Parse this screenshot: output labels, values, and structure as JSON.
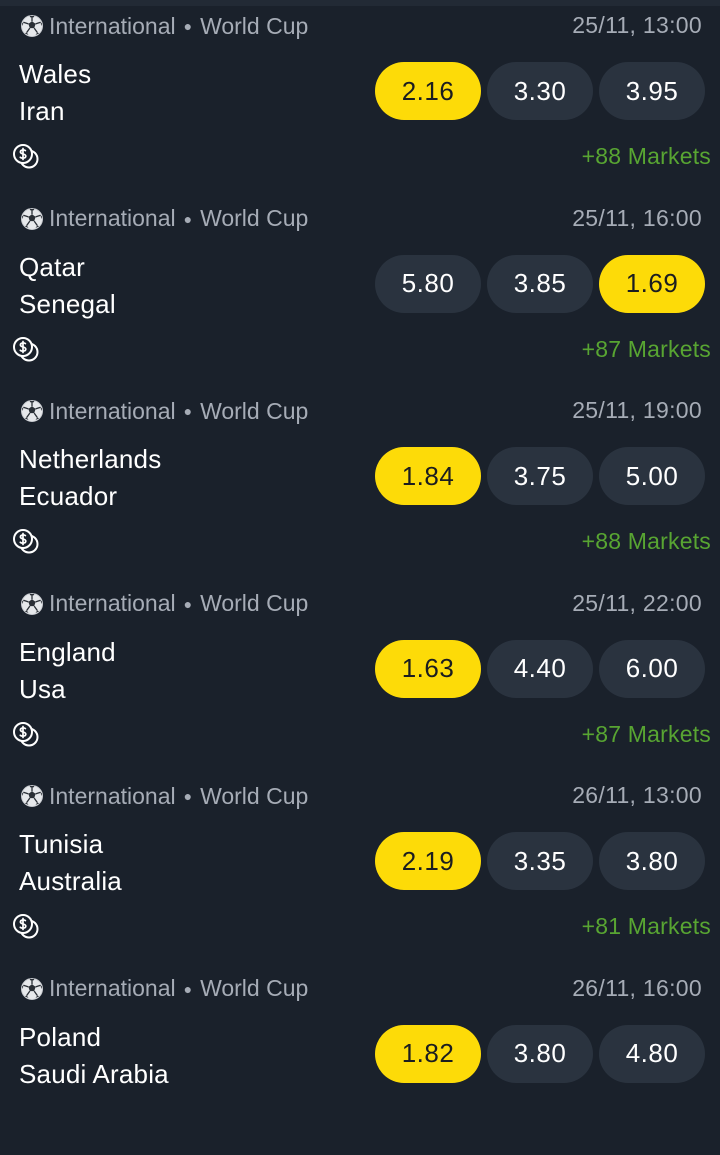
{
  "colors": {
    "background": "#1a212b",
    "odds_button": "#2a333f",
    "odds_highlight": "#fddb08",
    "markets_green": "#58a532",
    "meta_gray": "#a6acb6"
  },
  "events": [
    {
      "sport_icon": "soccer-ball-icon",
      "category": "International",
      "league": "World Cup",
      "datetime": "25/11, 13:00",
      "home": "Wales",
      "away": "Iran",
      "odds": [
        "2.16",
        "3.30",
        "3.95"
      ],
      "highlight_index": 0,
      "markets": "+88 Markets",
      "cashout_icon": "cashout-coin-icon"
    },
    {
      "sport_icon": "soccer-ball-icon",
      "category": "International",
      "league": "World Cup",
      "datetime": "25/11, 16:00",
      "home": "Qatar",
      "away": "Senegal",
      "odds": [
        "5.80",
        "3.85",
        "1.69"
      ],
      "highlight_index": 2,
      "markets": "+87 Markets",
      "cashout_icon": "cashout-coin-icon"
    },
    {
      "sport_icon": "soccer-ball-icon",
      "category": "International",
      "league": "World Cup",
      "datetime": "25/11, 19:00",
      "home": "Netherlands",
      "away": "Ecuador",
      "odds": [
        "1.84",
        "3.75",
        "5.00"
      ],
      "highlight_index": 0,
      "markets": "+88 Markets",
      "cashout_icon": "cashout-coin-icon"
    },
    {
      "sport_icon": "soccer-ball-icon",
      "category": "International",
      "league": "World Cup",
      "datetime": "25/11, 22:00",
      "home": "England",
      "away": "Usa",
      "odds": [
        "1.63",
        "4.40",
        "6.00"
      ],
      "highlight_index": 0,
      "markets": "+87 Markets",
      "cashout_icon": "cashout-coin-icon"
    },
    {
      "sport_icon": "soccer-ball-icon",
      "category": "International",
      "league": "World Cup",
      "datetime": "26/11, 13:00",
      "home": "Tunisia",
      "away": "Australia",
      "odds": [
        "2.19",
        "3.35",
        "3.80"
      ],
      "highlight_index": 0,
      "markets": "+81 Markets",
      "cashout_icon": "cashout-coin-icon"
    },
    {
      "sport_icon": "soccer-ball-icon",
      "category": "International",
      "league": "World Cup",
      "datetime": "26/11, 16:00",
      "home": "Poland",
      "away": "Saudi Arabia",
      "odds": [
        "1.82",
        "3.80",
        "4.80"
      ],
      "highlight_index": 0,
      "markets": "",
      "cashout_icon": ""
    }
  ]
}
